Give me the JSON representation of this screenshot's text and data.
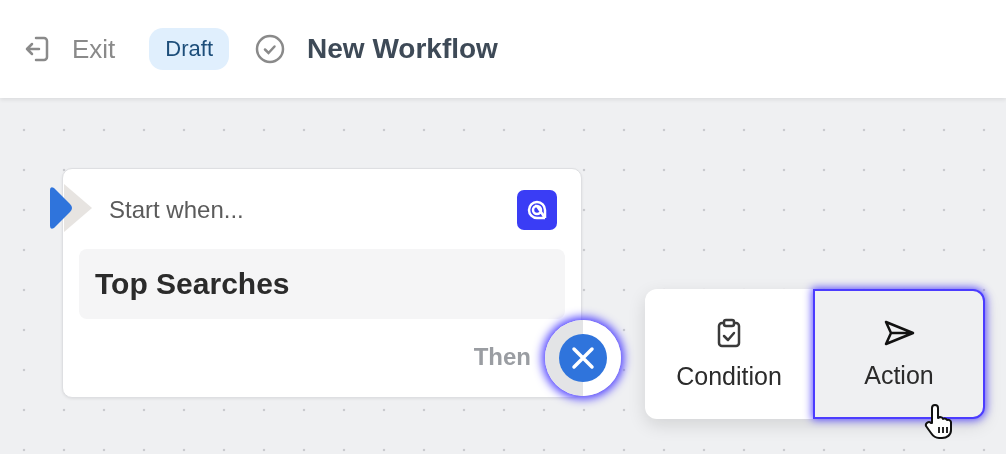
{
  "header": {
    "exit_label": "Exit",
    "status_badge": "Draft",
    "title": "New Workflow"
  },
  "trigger": {
    "label": "Start when...",
    "value": "Top Searches",
    "then_label": "Then"
  },
  "menu": {
    "options": [
      {
        "label": "Condition",
        "kind": "condition",
        "selected": false
      },
      {
        "label": "Action",
        "kind": "action",
        "selected": true
      }
    ]
  }
}
